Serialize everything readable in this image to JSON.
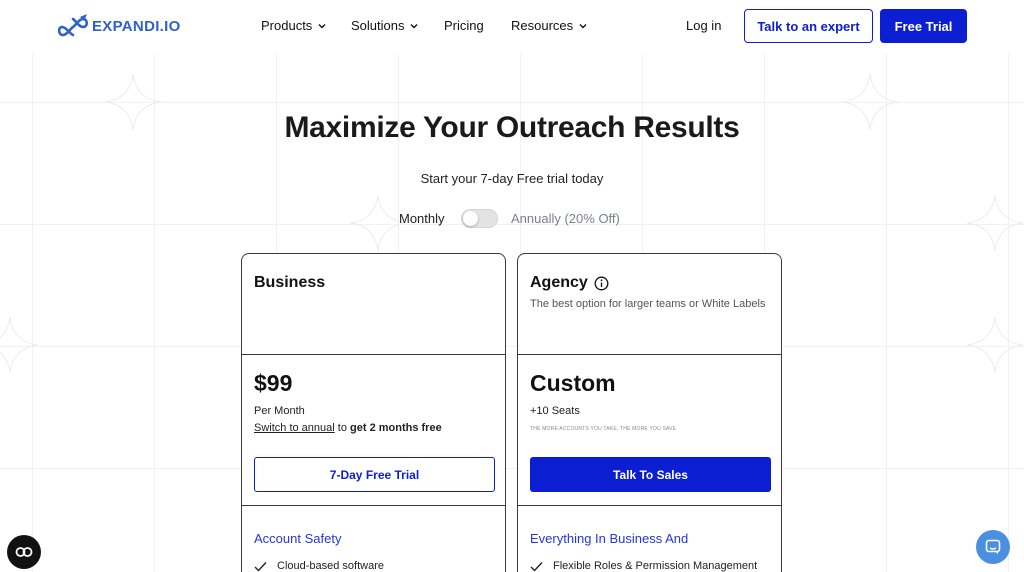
{
  "header": {
    "logo_text": "EXPANDI.IO",
    "nav": [
      {
        "label": "Products"
      },
      {
        "label": "Solutions"
      },
      {
        "label": "Pricing"
      },
      {
        "label": "Resources"
      }
    ],
    "login_label": "Log in",
    "expert_label": "Talk to an expert",
    "trial_label": "Free Trial"
  },
  "hero": {
    "title": "Maximize Your Outreach Results",
    "subtitle": "Start your 7-day Free trial today",
    "toggle": {
      "left_label": "Monthly",
      "right_label": "Annually (20% Off)",
      "state": "Monthly"
    }
  },
  "plans": [
    {
      "name": "Business",
      "description": "",
      "price": "$99",
      "per": "Per Month",
      "switch_link": "Switch to annual",
      "switch_rest_1": " to ",
      "switch_bold": "get 2 months free",
      "cta": "7-Day Free Trial",
      "features_title": "Account Safety",
      "first_feature": "Cloud-based software"
    },
    {
      "name": "Agency",
      "description": "The best option for larger teams or White Labels",
      "price": "Custom",
      "per": "+10 Seats",
      "note": "THE MORE ACCOUNTS YOU TAKE, THE MORE YOU SAVE",
      "cta": "Talk To Sales",
      "features_title": "Everything In Business And",
      "first_feature": "Flexible Roles & Permission Management"
    }
  ],
  "colors": {
    "brand_blue": "#0c1ed1",
    "logo_blue": "#2f62c9",
    "link_blue": "#2437d8",
    "chat_bubble": "#4a8fe0"
  },
  "icons": {
    "logo": "rocket-infinity-icon",
    "chevron": "chevron-down-icon",
    "info": "info-circle-icon",
    "check": "checkmark-icon",
    "accessibility": "accessibility-widget-icon",
    "chat": "chat-bubble-icon"
  }
}
